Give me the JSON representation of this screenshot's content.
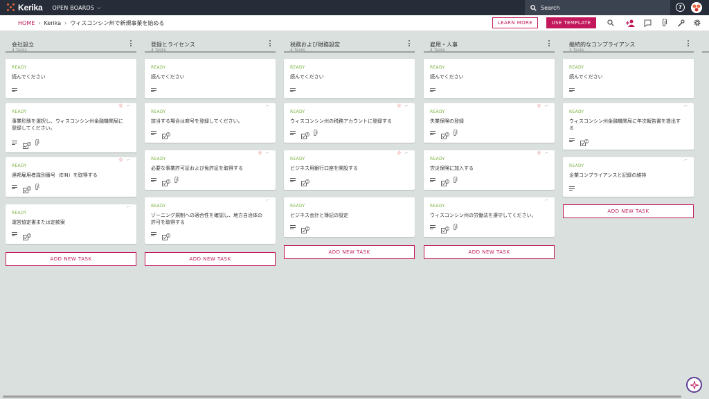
{
  "nav": {
    "app_name": "Kerika",
    "open_boards": "OPEN BOARDS",
    "search_placeholder": "Search",
    "help": "?"
  },
  "breadcrumb": {
    "home": "HOME",
    "account": "Kerika",
    "board": "ウィスコンシン州で新規事業を始める"
  },
  "actions": {
    "learn_more": "LEARN MORE",
    "use_template": "USE TEMPLATE"
  },
  "colors": {
    "accent": "#c2185b",
    "status_ready": "#7cb342",
    "topbar": "#262c38",
    "board_bg": "#d9e0dd"
  },
  "add_task_label": "ADD NEW TASK",
  "columns": [
    {
      "title": "会社設立",
      "count": "4 Tasks",
      "cards": [
        {
          "status": "READY",
          "title": "読んでください",
          "check_count": "",
          "star": false
        },
        {
          "status": "READY",
          "title": "事業形態を選択し、ウィスコンシン州金融機関局に登録してください。",
          "check_count": "2",
          "star": true
        },
        {
          "status": "READY",
          "title": "連邦雇用者識別番号（EIN）を取得する",
          "check_count": "2",
          "star": true
        },
        {
          "status": "READY",
          "title": "運営協定書または定款案",
          "check_count": "2",
          "star": false
        }
      ]
    },
    {
      "title": "登録とライセンス",
      "count": "4 Tasks",
      "cards": [
        {
          "status": "READY",
          "title": "読んでください",
          "check_count": "",
          "star": false
        },
        {
          "status": "READY",
          "title": "該当する場合は商号を登録してください。",
          "check_count": "2",
          "star": false
        },
        {
          "status": "READY",
          "title": "必要な事業許可証および免許証を取得する",
          "check_count": "2",
          "star": true
        },
        {
          "status": "READY",
          "title": "ゾーニング規制への適合性を確認し、地方自治体の許可を取得する",
          "check_count": "2",
          "star": false
        }
      ]
    },
    {
      "title": "税務および財務設定",
      "count": "4 Tasks",
      "cards": [
        {
          "status": "READY",
          "title": "読んでください",
          "check_count": "",
          "star": false
        },
        {
          "status": "READY",
          "title": "ウィスコンシン州の税務アカウントに登録する",
          "check_count": "4",
          "star": true
        },
        {
          "status": "READY",
          "title": "ビジネス用銀行口座を開設する",
          "check_count": "2",
          "star": true
        },
        {
          "status": "READY",
          "title": "ビジネス会計と簿記の設定",
          "check_count": "2",
          "star": false
        }
      ]
    },
    {
      "title": "雇用・人事",
      "count": "4 Tasks",
      "cards": [
        {
          "status": "READY",
          "title": "読んでください",
          "check_count": "",
          "star": false
        },
        {
          "status": "READY",
          "title": "失業保険の登録",
          "check_count": "2",
          "star": true
        },
        {
          "status": "READY",
          "title": "労災保険に加入する",
          "check_count": "2",
          "star": true
        },
        {
          "status": "READY",
          "title": "ウィスコンシン州の労働法を遵守してください。",
          "check_count": "2",
          "star": false
        }
      ]
    },
    {
      "title": "継続的なコンプライアンス",
      "count": "3 Tasks",
      "cards": [
        {
          "status": "READY",
          "title": "読んでください",
          "check_count": "",
          "star": false
        },
        {
          "status": "READY",
          "title": "ウィスコンシン州金融機関局に年次報告書を提出する",
          "check_count": "2",
          "star": false
        },
        {
          "status": "READY",
          "title": "企業コンプライアンスと記録の維持",
          "check_count": "",
          "star": false
        }
      ]
    }
  ]
}
